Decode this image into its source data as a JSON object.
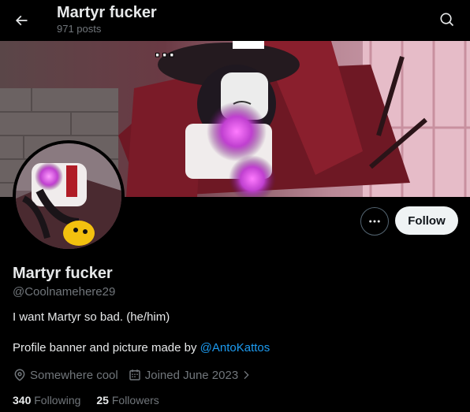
{
  "header": {
    "title": "Martyr fucker",
    "posts_count": "971 posts",
    "back_icon": "arrow-left-icon",
    "search_icon": "search-icon"
  },
  "profile": {
    "name": "Martyr fucker",
    "handle": "@Coolnamehere29",
    "bio_line1": "I want Martyr so bad. (he/him)",
    "bio_line2_prefix": "Profile banner and picture made by ",
    "bio_mention": "@AntoKattos",
    "location": "Somewhere cool",
    "joined": "Joined June 2023",
    "follow_label": "Follow",
    "following_count": "340",
    "following_label": "Following",
    "followers_count": "25",
    "followers_label": "Followers"
  },
  "colors": {
    "background": "#000000",
    "primary_text": "#e7e9ea",
    "secondary_text": "#71767b",
    "link": "#1d9bf0",
    "follow_bg": "#eff3f4"
  }
}
